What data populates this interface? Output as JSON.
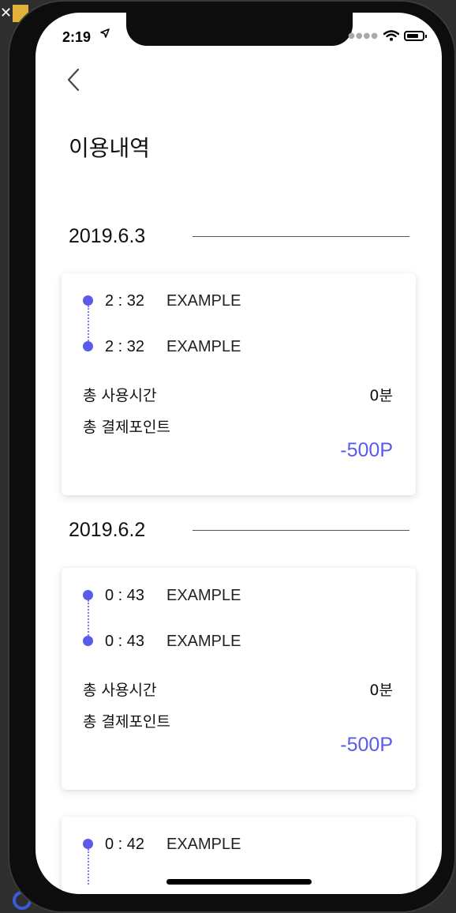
{
  "status_bar": {
    "time": "2:19",
    "location_icon": "location-arrow-icon",
    "signal_icon": "signal-dots-icon",
    "wifi_icon": "wifi-icon",
    "battery_icon": "battery-icon"
  },
  "header": {
    "back_icon": "chevron-left-icon",
    "title": "이용내역"
  },
  "accent_color": "#5a5bea",
  "history": [
    {
      "date": "2019.6.3",
      "start_time": "2 : 32",
      "start_place": "EXAMPLE",
      "end_time": "2 : 32",
      "end_place": "EXAMPLE",
      "usage_label": "총 사용시간",
      "usage_value": "0분",
      "points_label": "총 결제포인트",
      "points_value": "-500P"
    },
    {
      "date": "2019.6.2",
      "start_time": "0 : 43",
      "start_place": "EXAMPLE",
      "end_time": "0 : 43",
      "end_place": "EXAMPLE",
      "usage_label": "총 사용시간",
      "usage_value": "0분",
      "points_label": "총 결제포인트",
      "points_value": "-500P"
    },
    {
      "start_time": "0 : 42",
      "start_place": "EXAMPLE"
    }
  ]
}
